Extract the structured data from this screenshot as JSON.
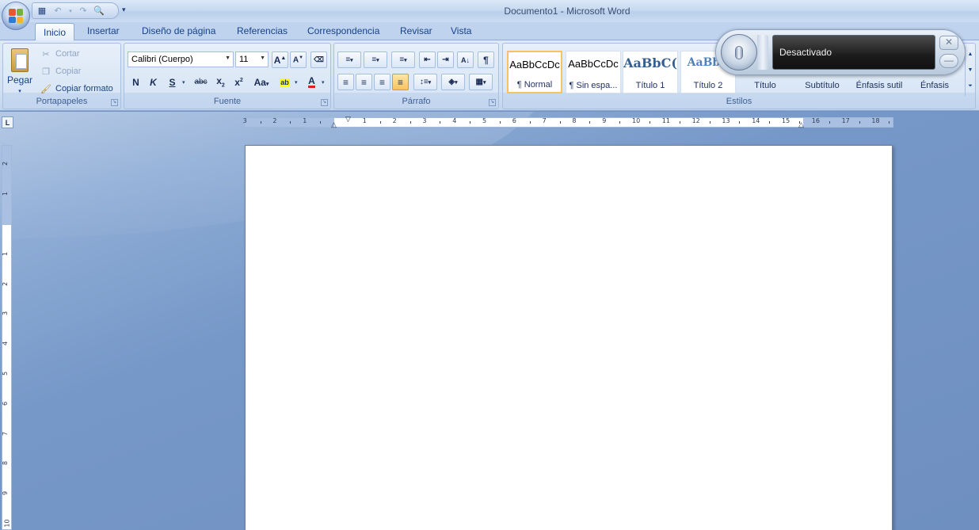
{
  "window": {
    "title": "Documento1 - Microsoft Word"
  },
  "tabs": [
    "Inicio",
    "Insertar",
    "Diseño de página",
    "Referencias",
    "Correspondencia",
    "Revisar",
    "Vista"
  ],
  "clipboard": {
    "group_label": "Portapapeles",
    "paste_label": "Pegar",
    "cut_label": "Cortar",
    "copy_label": "Copiar",
    "format_painter_label": "Copiar formato"
  },
  "font": {
    "group_label": "Fuente",
    "font_name": "Calibri (Cuerpo)",
    "font_size": "11"
  },
  "paragraph": {
    "group_label": "Párrafo"
  },
  "styles": {
    "group_label": "Estilos",
    "items": [
      {
        "sample": "AaBbCcDc",
        "name": "¶ Normal"
      },
      {
        "sample": "AaBbCcDc",
        "name": "¶ Sin espa..."
      },
      {
        "sample": "AaBbC(",
        "name": "Título 1"
      },
      {
        "sample": "AaBbC",
        "name": "Título 2"
      },
      {
        "sample": "",
        "name": "Título"
      },
      {
        "sample": "",
        "name": "Subtítulo"
      },
      {
        "sample": "",
        "name": "Énfasis sutil"
      },
      {
        "sample": "",
        "name": "Énfasis"
      }
    ]
  },
  "speech": {
    "status": "Desactivado"
  },
  "ruler": {
    "h_labels": [
      "3",
      "2",
      "1",
      "1",
      "2",
      "3",
      "4",
      "5",
      "6",
      "7",
      "8",
      "9",
      "10",
      "11",
      "12",
      "13",
      "14",
      "15",
      "16",
      "17",
      "18"
    ],
    "v_labels": [
      "2",
      "1",
      "1",
      "2",
      "3",
      "4",
      "5",
      "6",
      "7",
      "8",
      "9",
      "10"
    ]
  },
  "colors": {
    "accent": "#15428b",
    "ribbon": "#dee9f7",
    "workspace": "#6e8fc0",
    "highlight": "#f3c45f"
  }
}
